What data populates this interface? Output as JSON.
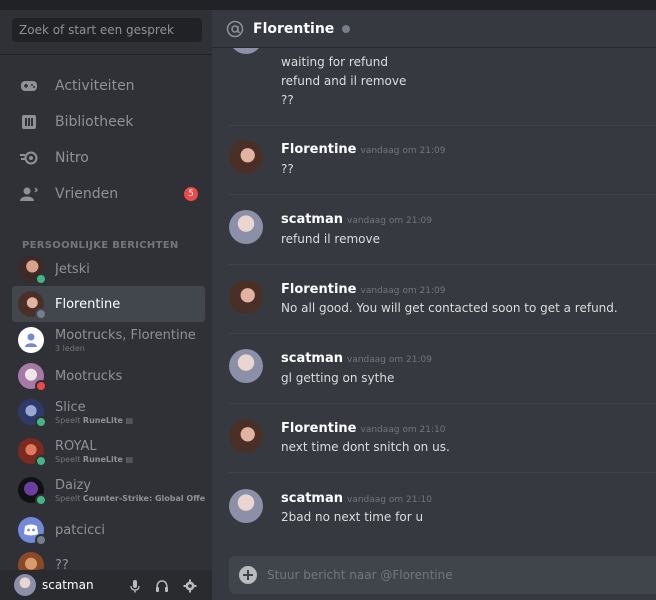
{
  "search": {
    "placeholder": "Zoek of start een gesprek"
  },
  "nav": [
    {
      "label": "Activiteiten",
      "icon": "gamepad-icon"
    },
    {
      "label": "Bibliotheek",
      "icon": "library-icon"
    },
    {
      "label": "Nitro",
      "icon": "nitro-icon"
    },
    {
      "label": "Vrienden",
      "icon": "friends-icon",
      "badge": "5"
    }
  ],
  "dm_header": "PERSOONLIJKE BERICHTEN",
  "dms": [
    {
      "name": "Jetski",
      "status": "online"
    },
    {
      "name": "Florentine",
      "status": "offline",
      "active": true
    },
    {
      "name": "Mootrucks, Florentine",
      "sub": "3 leden"
    },
    {
      "name": "Mootrucks",
      "status": "dnd"
    },
    {
      "name": "Slice",
      "sub_prefix": "Speelt",
      "sub_game": "RuneLite",
      "status": "online"
    },
    {
      "name": "ROYAL",
      "sub_prefix": "Speelt",
      "sub_game": "RuneLite",
      "status": "online"
    },
    {
      "name": "Daizy",
      "sub_prefix": "Speelt",
      "sub_game": "Counter-Strike: Global Offen...",
      "status": "online"
    },
    {
      "name": "patcicci",
      "status": "offline"
    },
    {
      "name": "??",
      "status": "offline"
    }
  ],
  "user": {
    "name": "scatman"
  },
  "chat": {
    "title": "Florentine",
    "top_lines": [
      "waiting for refund",
      "refund and il remove",
      "??"
    ],
    "messages": [
      {
        "author": "Florentine",
        "time": "vandaag om 21:09",
        "text": "??"
      },
      {
        "author": "scatman",
        "time": "vandaag om 21:09",
        "text": "refund il remove"
      },
      {
        "author": "Florentine",
        "time": "vandaag om 21:09",
        "text": "No all good. You will get contacted soon to get a refund."
      },
      {
        "author": "scatman",
        "time": "vandaag om 21:09",
        "text": "gl getting on sythe"
      },
      {
        "author": "Florentine",
        "time": "vandaag om 21:10",
        "text": "next time dont snitch on us."
      },
      {
        "author": "scatman",
        "time": "vandaag om 21:10",
        "text": "2bad no next time for u"
      }
    ],
    "composer_placeholder": "Stuur bericht naar @Florentine"
  },
  "colors": {
    "accent": "#7289da",
    "online": "#43b581",
    "dnd": "#f04747",
    "offline": "#747f8d"
  }
}
